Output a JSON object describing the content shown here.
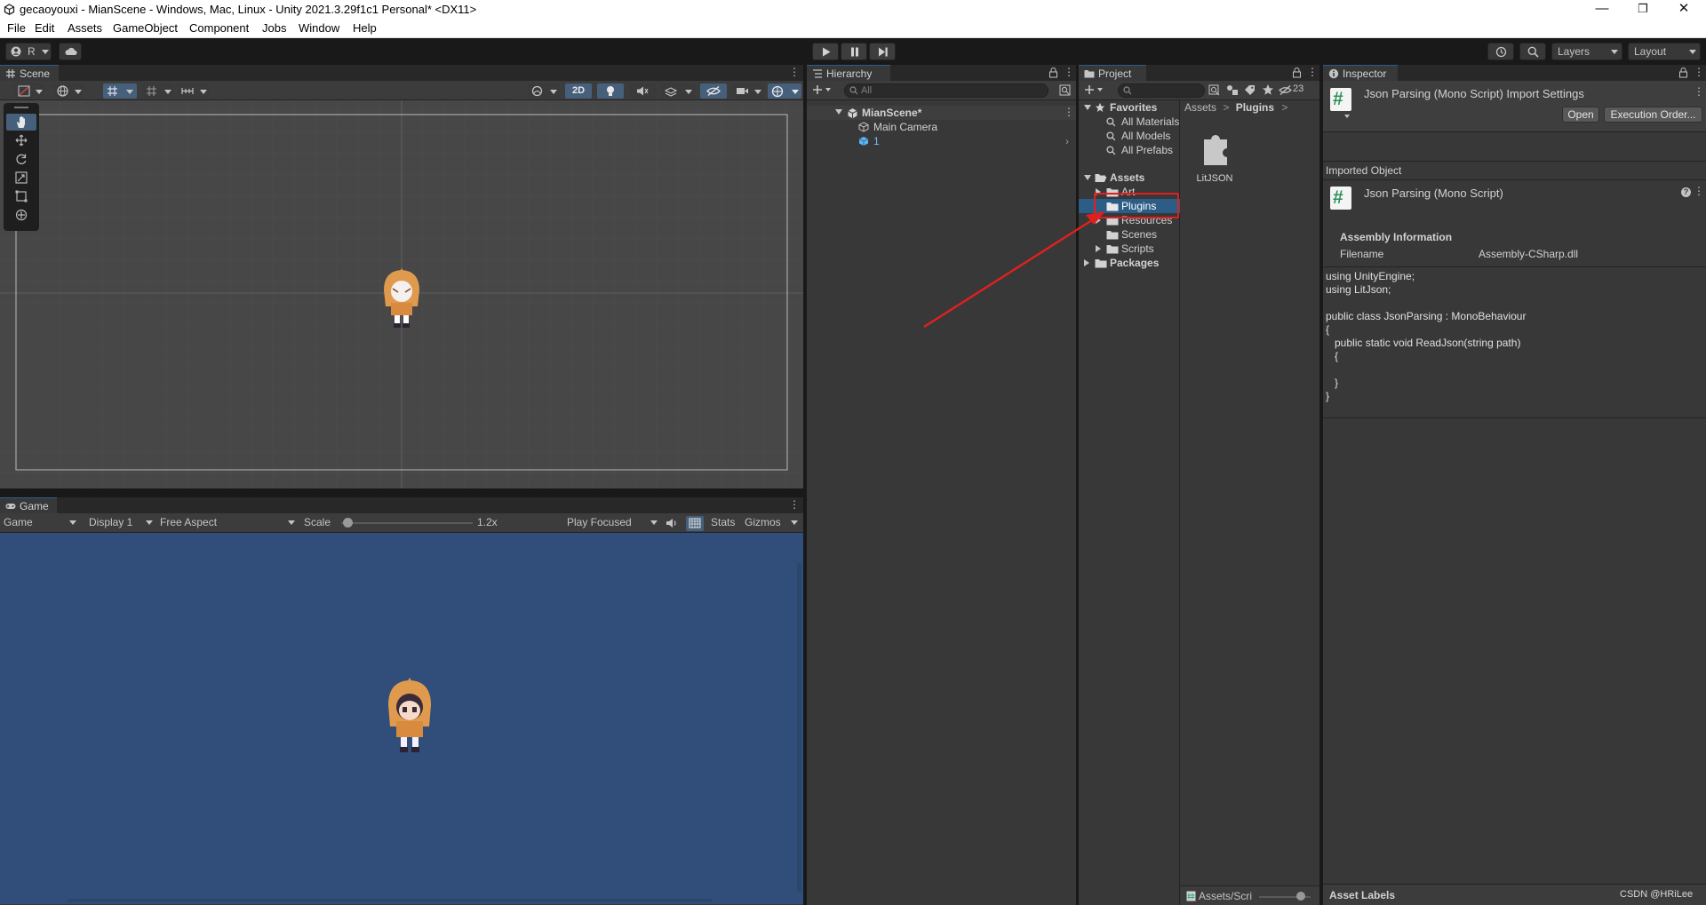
{
  "window": {
    "title": "gecaoyouxi - MianScene - Windows, Mac, Linux - Unity 2021.3.29f1c1 Personal* <DX11>",
    "minimize_glyph": "—",
    "restore_glyph": "❐",
    "close_glyph": "✕"
  },
  "menu": [
    "File",
    "Edit",
    "Assets",
    "GameObject",
    "Component",
    "Jobs",
    "Window",
    "Help"
  ],
  "toolbar": {
    "account_label": "R",
    "layers_label": "Layers",
    "layout_label": "Layout"
  },
  "scene": {
    "tab_label": "Scene",
    "mode_2d_label": "2D"
  },
  "game": {
    "tab_label": "Game",
    "view_select": "Game",
    "display_select": "Display 1",
    "aspect_select": "Free Aspect",
    "scale_label": "Scale",
    "scale_value": "1.2x",
    "scale_fraction": 0.05,
    "play_mode_select": "Play Focused",
    "stats_label": "Stats",
    "gizmos_label": "Gizmos"
  },
  "hierarchy": {
    "tab_label": "Hierarchy",
    "search_placeholder": "All",
    "scene_name": "MianScene*",
    "items": [
      "Main Camera",
      "1"
    ]
  },
  "project": {
    "tab_label": "Project",
    "hidden_count": "23",
    "favorites_label": "Favorites",
    "favorites": [
      "All Materials",
      "All Models",
      "All Prefabs"
    ],
    "assets_label": "Assets",
    "asset_folders": [
      "Art",
      "Plugins",
      "Resources",
      "Scenes",
      "Scripts"
    ],
    "packages_label": "Packages",
    "breadcrumb": [
      "Assets",
      "Plugins"
    ],
    "breadcrumb_sep": ">",
    "grid_items": [
      "LitJSON"
    ],
    "footer_path": "Assets/Scri"
  },
  "inspector": {
    "tab_label": "Inspector",
    "header_title": "Json Parsing (Mono Script) Import Settings",
    "open_label": "Open",
    "exec_order_label": "Execution Order...",
    "imported_object_label": "Imported Object",
    "object_title": "Json Parsing (Mono Script)",
    "assembly_heading": "Assembly Information",
    "filename_label": "Filename",
    "filename_value": "Assembly-CSharp.dll",
    "code_lines": [
      "using UnityEngine;",
      "using LitJson;",
      "",
      "public class JsonParsing : MonoBehaviour",
      "{",
      "   public static void ReadJson(string path)",
      "   {",
      "",
      "   }",
      "}"
    ],
    "asset_labels_label": "Asset Labels"
  },
  "watermark": "CSDN @HRiLee",
  "colors": {
    "selection": "#2c5d87",
    "annotation_red": "#e02020",
    "game_background": "#314d79",
    "scene_background": "#474747",
    "panel": "#383838"
  }
}
